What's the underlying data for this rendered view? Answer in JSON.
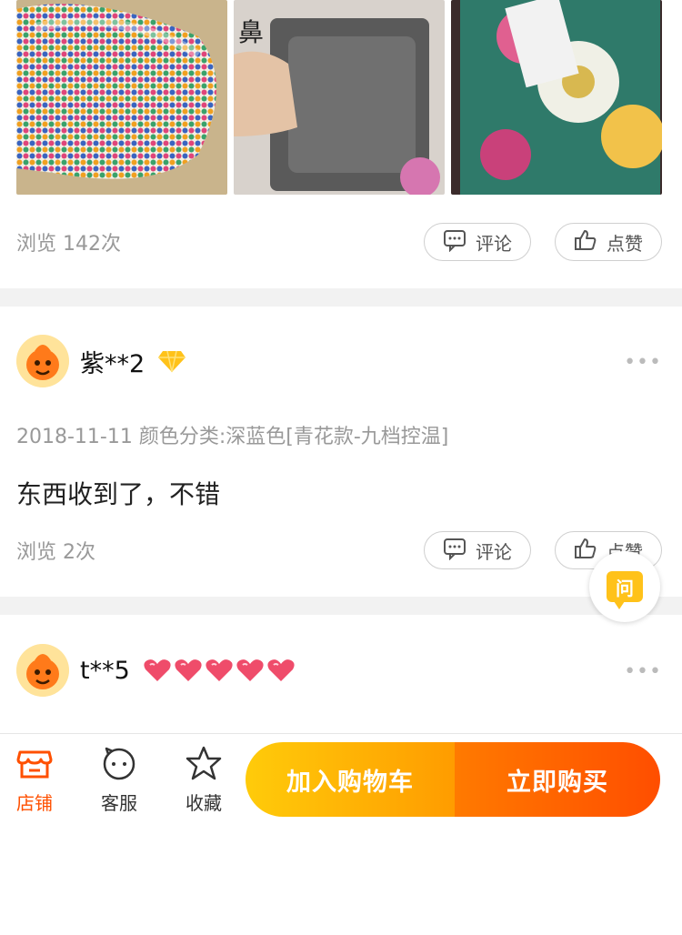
{
  "review1": {
    "views": "浏览 142次",
    "comment_label": "评论",
    "like_label": "点赞"
  },
  "review2": {
    "username": "紫**2",
    "badge_icon": "diamond-icon",
    "meta": "2018-11-11 颜色分类:深蓝色[青花款-九档控温]",
    "text": "东西收到了，不错",
    "views": "浏览 2次",
    "comment_label": "评论",
    "like_label": "点赞"
  },
  "review3": {
    "username": "t**5",
    "badge_icon": "hearts-icon",
    "heart_count": 5
  },
  "ask_button": {
    "label": "问"
  },
  "bottom_bar": {
    "tabs": [
      {
        "label": "店铺",
        "icon": "store-icon"
      },
      {
        "label": "客服",
        "icon": "chat-icon"
      },
      {
        "label": "收藏",
        "icon": "star-icon"
      }
    ],
    "add_to_cart": "加入购物车",
    "buy_now": "立即购买"
  },
  "colors": {
    "accent": "#ff5000",
    "cart_gradient": [
      "#ffcb0a",
      "#ff9c00"
    ],
    "buy_gradient": [
      "#ff7a00",
      "#ff4e00"
    ],
    "ask_yellow": "#ffc21a"
  }
}
